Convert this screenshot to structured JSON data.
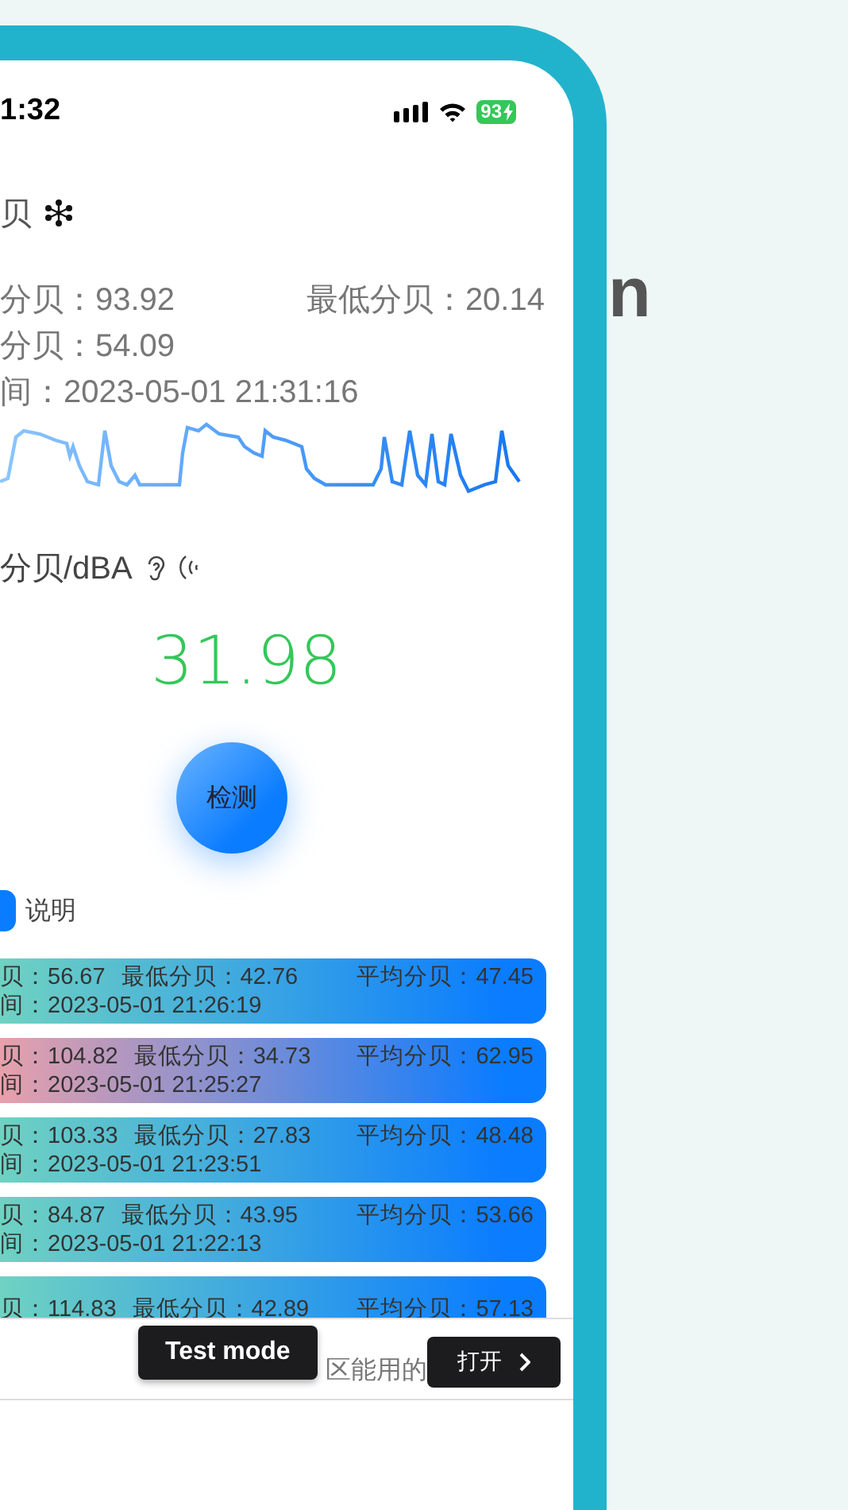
{
  "headline_fragment": "n",
  "status_bar": {
    "time": "1:32",
    "battery": "93"
  },
  "title": "贝",
  "stats_rows": [
    [
      "分贝：93.92",
      "最低分贝：20.14"
    ],
    [
      "分贝：54.09"
    ],
    [
      "间：2023-05-01 21:31:16"
    ]
  ],
  "unit_label": "分贝/dBA",
  "reading": "31.98",
  "detect_button": "检测",
  "help_link": "说明",
  "history": [
    {
      "color": "#6fd2c2",
      "max": "贝：56.67",
      "min": "最低分贝：42.76",
      "avg": "平均分贝：47.45",
      "time": "间：2023-05-01 21:26:19"
    },
    {
      "color": "#e8a0ab",
      "max": "贝：104.82",
      "min": "最低分贝：34.73",
      "avg": "平均分贝：62.95",
      "time": "间：2023-05-01 21:25:27"
    },
    {
      "color": "#6fd2c2",
      "max": "贝：103.33",
      "min": "最低分贝：27.83",
      "avg": "平均分贝：48.48",
      "time": "间：2023-05-01 21:23:51"
    },
    {
      "color": "#6fd2c2",
      "max": "贝：84.87",
      "min": "最低分贝：43.95",
      "avg": "平均分贝：53.66",
      "time": "间：2023-05-01 21:22:13"
    },
    {
      "color": "#6fd2c2",
      "max": "贝：114.83",
      "min": "最低分贝：42.89",
      "avg": "平均分贝：57.13"
    }
  ],
  "ad": {
    "badge": "Test mode",
    "text": "区能用的",
    "button": "打开"
  }
}
